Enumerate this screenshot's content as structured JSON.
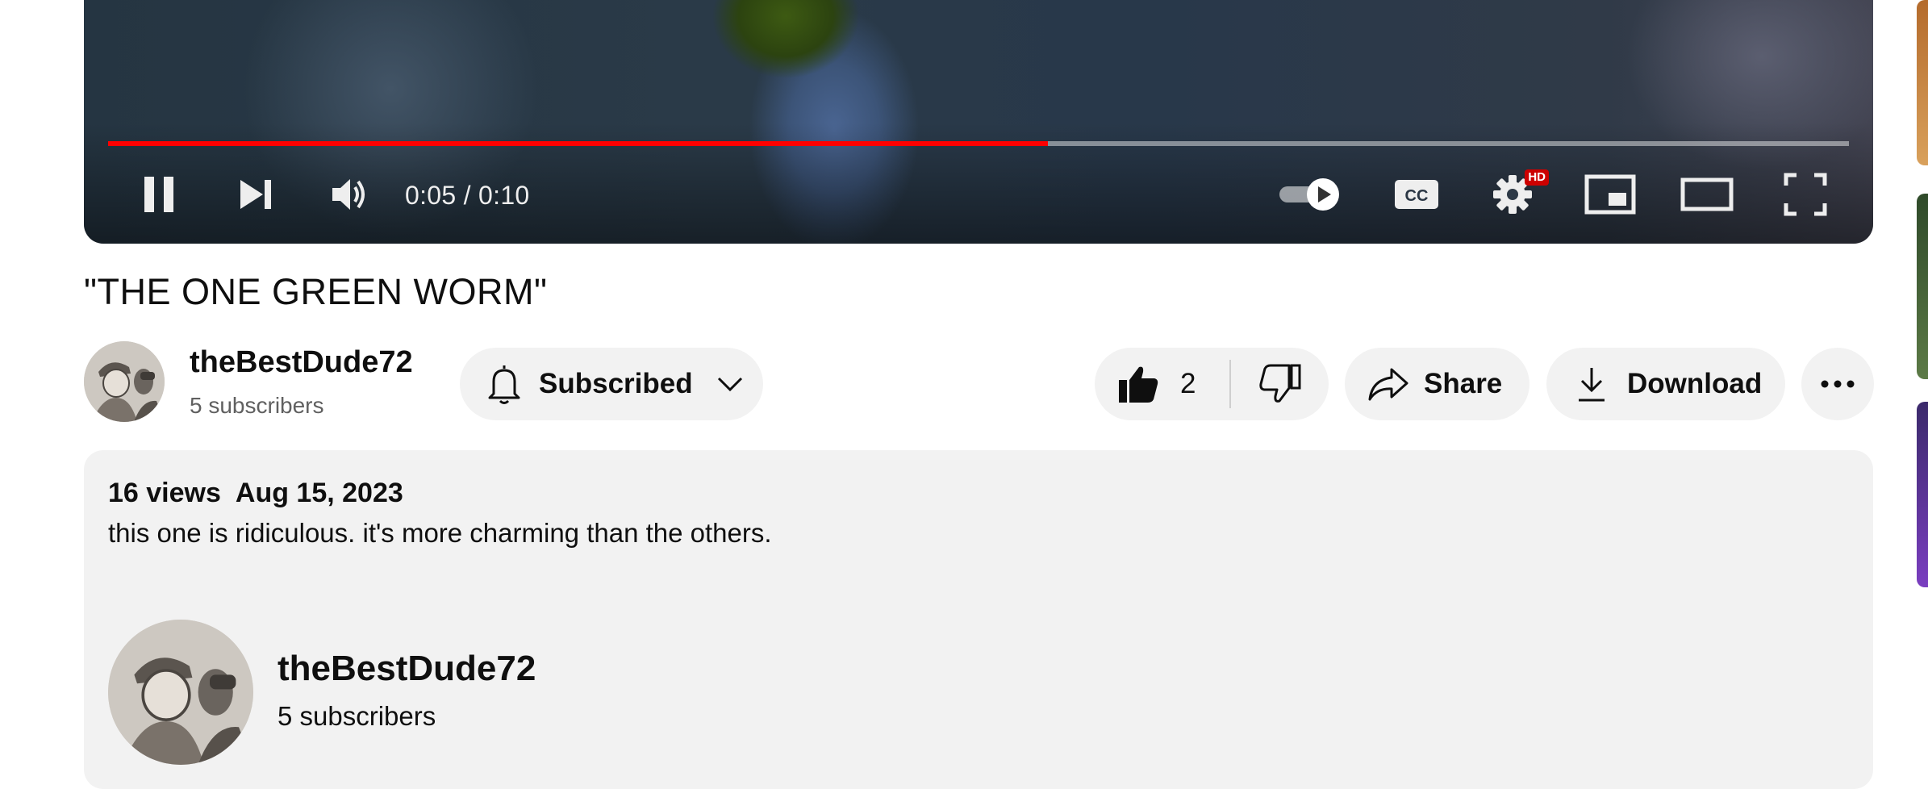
{
  "player": {
    "time_current": "0:05",
    "time_total": "0:10",
    "time_display": "0:05 / 0:10",
    "progress_fraction": 0.54,
    "autoplay_on": true,
    "hd_badge": "HD",
    "cc_label": "CC",
    "progress_color": "#ff0000"
  },
  "video": {
    "title": "\"THE ONE GREEN WORM\""
  },
  "owner": {
    "channel_name": "theBestDude72",
    "subscribers": "5 subscribers"
  },
  "actions": {
    "subscribe_label": "Subscribed",
    "like_count": "2",
    "share_label": "Share",
    "download_label": "Download"
  },
  "description": {
    "views": "16 views",
    "date": "Aug 15, 2023",
    "text": "this one is ridiculous. it's more charming than the others.",
    "channel_name": "theBestDude72",
    "subscribers": "5 subscribers"
  },
  "icons": [
    "pause-icon",
    "next-icon",
    "volume-icon",
    "autoplay-toggle-icon",
    "cc-icon",
    "settings-icon",
    "miniplayer-icon",
    "theater-icon",
    "fullscreen-icon",
    "bell-icon",
    "chevron-down-icon",
    "thumbs-up-icon",
    "thumbs-down-icon",
    "share-icon",
    "download-icon",
    "more-icon"
  ]
}
